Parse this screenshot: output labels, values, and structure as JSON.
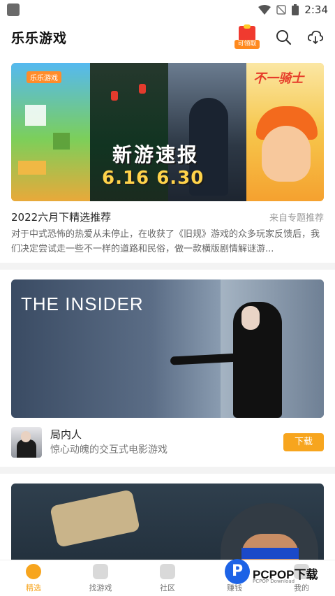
{
  "status_bar": {
    "time": "2:34"
  },
  "header": {
    "title": "乐乐游戏",
    "gift_label": "可领取"
  },
  "featured": {
    "banner_logo": "乐乐游戏",
    "banner_brand_right": "不一骑士",
    "banner_title": "新游速报",
    "banner_dates": "6.16  6.30",
    "title": "2022六月下精选推荐",
    "source": "来自专题推荐",
    "description": "对于中式恐怖的热爱从未停止，在收获了《旧规》游戏的众多玩家反馈后，我们决定尝试走一些不一样的道路和民俗，做一款横版剧情解谜游..."
  },
  "game_card": {
    "banner_title": "THE INSIDER",
    "name": "局内人",
    "description": "惊心动魄的交互式电影游戏",
    "download_label": "下载"
  },
  "bottom_nav": {
    "items": [
      {
        "label": "精选",
        "icon": "star-icon",
        "active": true
      },
      {
        "label": "找游戏",
        "icon": "gamepad-icon",
        "active": false
      },
      {
        "label": "社区",
        "icon": "chat-icon",
        "active": false
      },
      {
        "label": "赚钱",
        "icon": "coin-icon",
        "active": false
      },
      {
        "label": "我的",
        "icon": "profile-icon",
        "active": false
      }
    ]
  },
  "watermark": {
    "letter": "P",
    "text": "PCPOP下载",
    "sub": "PCPOP Download"
  },
  "colors": {
    "accent": "#f7a51e",
    "title_text": "#111111",
    "muted": "#999999"
  }
}
